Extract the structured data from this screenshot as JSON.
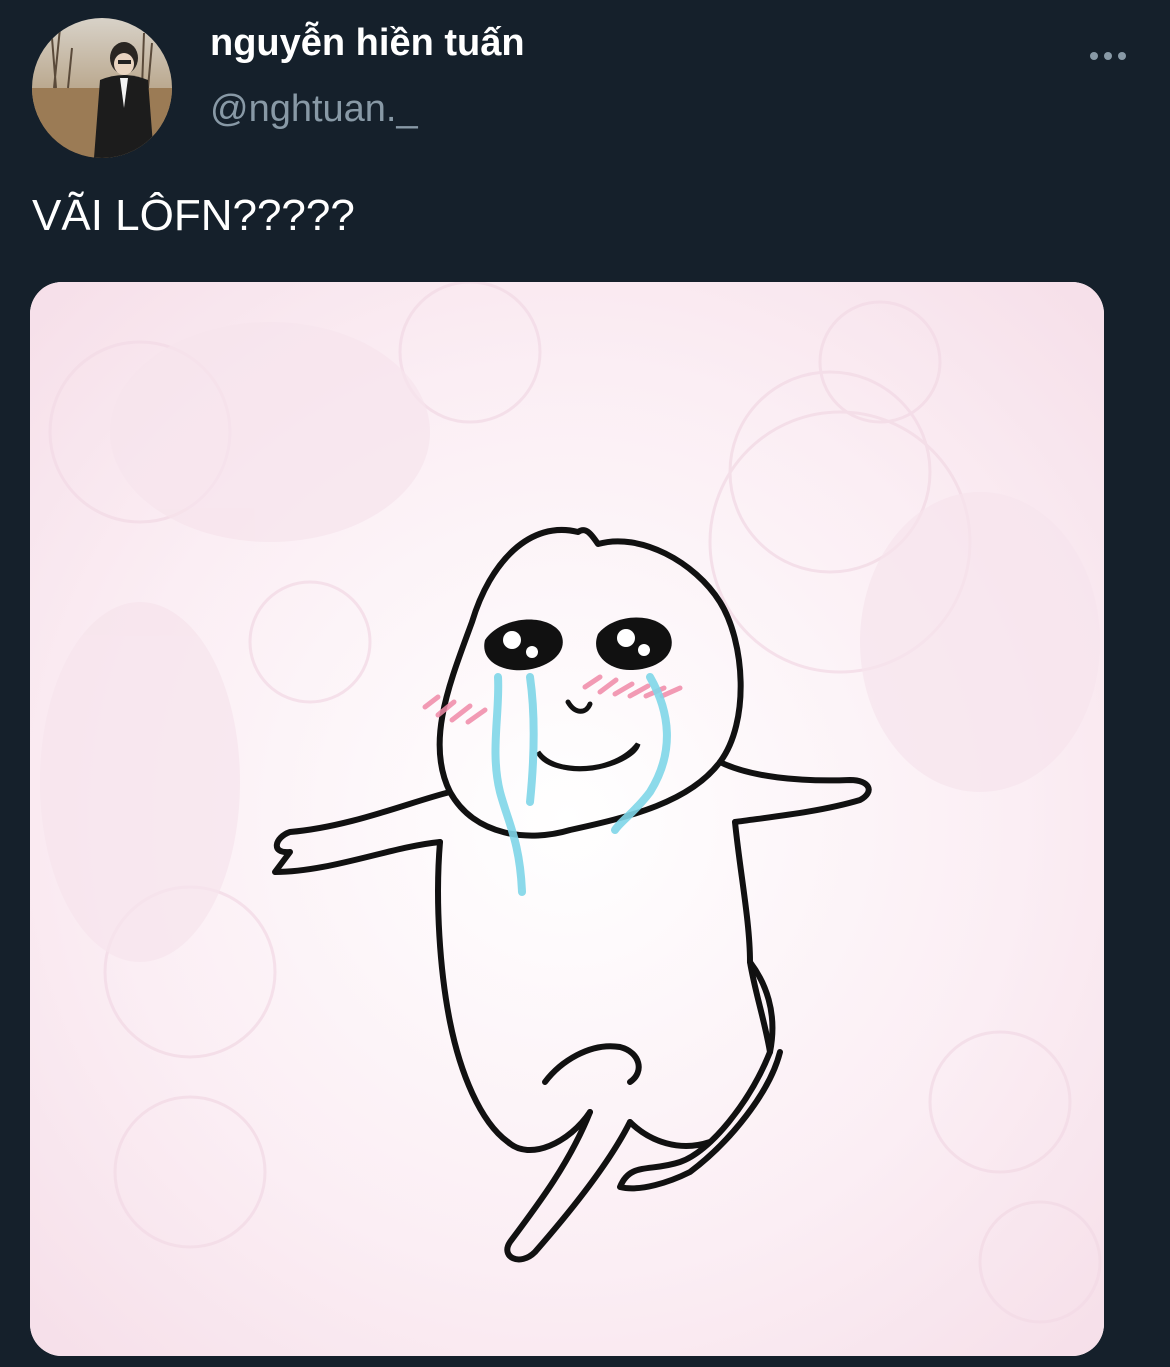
{
  "tweet": {
    "author": {
      "display_name": "nguyễn hiền tuấn",
      "handle": "@nghtuan._",
      "avatar_icon": "profile-photo"
    },
    "more_icon": "more-dots-icon",
    "text": "VÃI LÔFN?????",
    "media": {
      "type": "image",
      "description_icon": "crying-blob-meme-image"
    }
  },
  "colors": {
    "background": "#15202b",
    "primary_text": "#ffffff",
    "secondary_text": "#8899a6",
    "tear": "#7fd6e8",
    "blush": "#f08aa8"
  }
}
